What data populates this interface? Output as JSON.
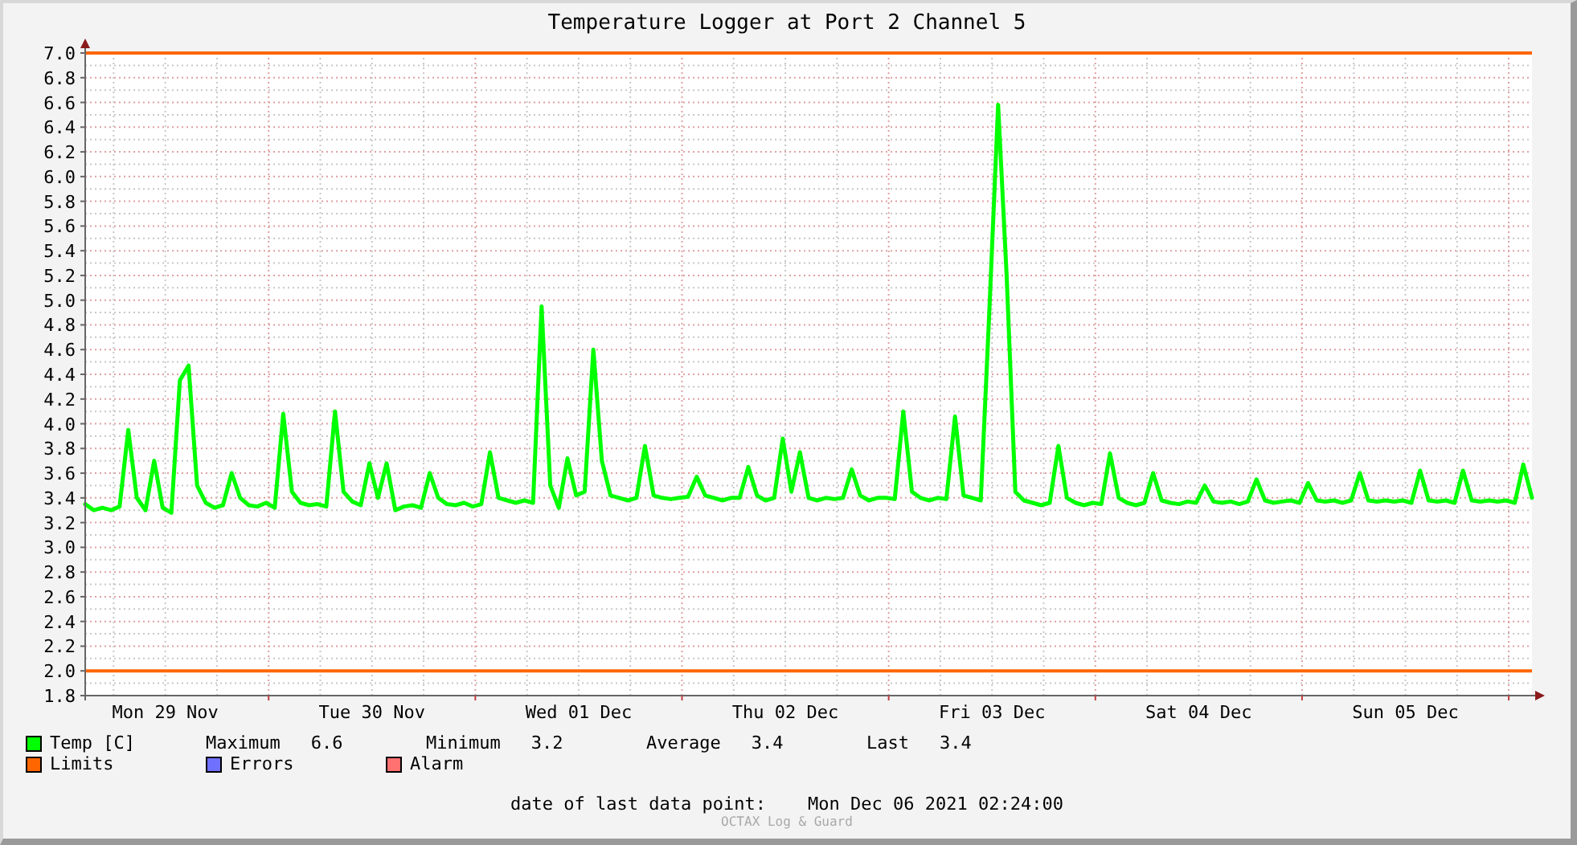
{
  "chart": {
    "chart_data": {
      "type": "line",
      "title": "Temperature Logger at Port 2 Channel 5",
      "categories": [
        null,
        null,
        null,
        null,
        null,
        null,
        null,
        null,
        null,
        "Mon 29 Nov",
        null,
        null,
        null,
        null,
        null,
        null,
        null,
        null,
        null,
        null,
        null,
        null,
        null,
        null,
        null,
        null,
        null,
        null,
        null,
        null,
        null,
        null,
        null,
        "Tue 30 Nov",
        null,
        null,
        null,
        null,
        null,
        null,
        null,
        null,
        null,
        null,
        null,
        null,
        null,
        null,
        null,
        null,
        null,
        null,
        null,
        null,
        null,
        null,
        null,
        "Wed 01 Dec",
        null,
        null,
        null,
        null,
        null,
        null,
        null,
        null,
        null,
        null,
        null,
        null,
        null,
        null,
        null,
        null,
        null,
        null,
        null,
        null,
        null,
        null,
        null,
        "Thu 02 Dec",
        null,
        null,
        null,
        null,
        null,
        null,
        null,
        null,
        null,
        null,
        null,
        null,
        null,
        null,
        null,
        null,
        null,
        null,
        null,
        null,
        null,
        null,
        null,
        "Fri 03 Dec",
        null,
        null,
        null,
        null,
        null,
        null,
        null,
        null,
        null,
        null,
        null,
        null,
        null,
        null,
        null,
        null,
        null,
        null,
        null,
        null,
        null,
        null,
        null,
        "Sat 04 Dec",
        null,
        null,
        null,
        null,
        null,
        null,
        null,
        null,
        null,
        null,
        null,
        null,
        null,
        null,
        null,
        null,
        null,
        null,
        null,
        null,
        null,
        null,
        null,
        "Sun 05 Dec",
        null,
        null,
        null,
        null,
        null,
        null,
        null,
        null,
        null,
        null,
        null,
        null,
        null,
        null,
        null
      ],
      "series": [
        {
          "name": "Temp [C]",
          "color": "#00ff00",
          "values": [
            3.35,
            3.3,
            3.32,
            3.3,
            3.33,
            3.95,
            3.4,
            3.3,
            3.7,
            3.32,
            3.28,
            4.35,
            4.47,
            3.5,
            3.36,
            3.32,
            3.34,
            3.6,
            3.4,
            3.34,
            3.33,
            3.36,
            3.32,
            4.08,
            3.45,
            3.36,
            3.34,
            3.35,
            3.33,
            4.1,
            3.45,
            3.37,
            3.34,
            3.68,
            3.4,
            3.68,
            3.3,
            3.33,
            3.34,
            3.32,
            3.6,
            3.4,
            3.35,
            3.34,
            3.36,
            3.33,
            3.35,
            3.77,
            3.4,
            3.38,
            3.36,
            3.38,
            3.36,
            4.95,
            3.5,
            3.32,
            3.72,
            3.42,
            3.45,
            4.6,
            3.7,
            3.42,
            3.4,
            3.38,
            3.4,
            3.82,
            3.42,
            3.4,
            3.39,
            3.4,
            3.41,
            3.57,
            3.42,
            3.4,
            3.38,
            3.4,
            3.4,
            3.65,
            3.42,
            3.38,
            3.4,
            3.88,
            3.45,
            3.77,
            3.4,
            3.38,
            3.4,
            3.39,
            3.4,
            3.63,
            3.42,
            3.38,
            3.4,
            3.4,
            3.39,
            4.1,
            3.45,
            3.4,
            3.38,
            3.4,
            3.39,
            4.06,
            3.42,
            3.4,
            3.38,
            4.93,
            6.58,
            5.2,
            3.45,
            3.38,
            3.36,
            3.34,
            3.36,
            3.82,
            3.4,
            3.36,
            3.34,
            3.36,
            3.35,
            3.76,
            3.4,
            3.36,
            3.34,
            3.36,
            3.6,
            3.38,
            3.36,
            3.35,
            3.37,
            3.36,
            3.5,
            3.37,
            3.36,
            3.37,
            3.35,
            3.37,
            3.55,
            3.38,
            3.36,
            3.37,
            3.38,
            3.36,
            3.52,
            3.38,
            3.37,
            3.38,
            3.36,
            3.38,
            3.6,
            3.38,
            3.37,
            3.38,
            3.37,
            3.38,
            3.36,
            3.62,
            3.38,
            3.37,
            3.38,
            3.36,
            3.62,
            3.38,
            3.37,
            3.38,
            3.37,
            3.38,
            3.36,
            3.67,
            3.4
          ]
        },
        {
          "name": "Limits",
          "color": "#ff6600",
          "values": [
            2,
            2,
            2,
            2,
            2,
            2,
            2,
            2,
            2,
            2,
            2,
            2,
            2,
            2,
            2,
            2,
            2,
            2,
            2,
            2,
            2,
            2,
            2,
            2,
            2,
            2,
            2,
            2,
            2,
            2,
            2,
            2,
            2,
            2,
            2,
            2,
            2,
            2,
            2,
            2,
            2,
            2,
            2,
            2,
            2,
            2,
            2,
            2,
            2,
            2,
            2,
            2,
            2,
            2,
            2,
            2,
            2,
            2,
            2,
            2,
            2,
            2,
            2,
            2,
            2,
            2,
            2,
            2,
            2,
            2,
            2,
            2,
            2,
            2,
            2,
            2,
            2,
            2,
            2,
            2,
            2,
            2,
            2,
            2,
            2,
            2,
            2,
            2,
            2,
            2,
            2,
            2,
            2,
            2,
            2,
            2,
            2,
            2,
            2,
            2,
            2,
            2,
            2,
            2,
            2,
            2,
            2,
            2,
            2,
            2,
            2,
            2,
            2,
            2,
            2,
            2,
            2,
            2,
            2,
            2,
            2,
            2,
            2,
            2,
            2,
            2,
            2,
            2,
            2,
            2,
            2,
            2,
            2,
            2,
            2,
            2,
            2,
            2,
            2,
            2,
            2,
            2,
            2,
            2,
            2,
            2,
            2,
            2,
            2,
            2,
            2,
            2,
            2,
            2,
            2,
            2,
            2,
            2,
            2,
            2,
            2,
            2,
            2,
            2,
            2,
            2,
            2,
            2,
            2
          ]
        }
      ],
      "ylim": [
        1.8,
        7.0
      ],
      "yticks": [
        {
          "value": 1.8,
          "label": "1.8"
        },
        {
          "value": 2.0,
          "label": "2.0"
        },
        {
          "value": 2.2,
          "label": "2.2"
        },
        {
          "value": 2.4,
          "label": "2.4"
        },
        {
          "value": 2.6,
          "label": "2.6"
        },
        {
          "value": 2.8,
          "label": "2.8"
        },
        {
          "value": 3.0,
          "label": "3.0"
        },
        {
          "value": 3.2,
          "label": "3.2"
        },
        {
          "value": 3.4,
          "label": "3.4"
        },
        {
          "value": 3.6,
          "label": "3.6"
        },
        {
          "value": 3.8,
          "label": "3.8"
        },
        {
          "value": 4.0,
          "label": "4.0"
        },
        {
          "value": 4.2,
          "label": "4.2"
        },
        {
          "value": 4.4,
          "label": "4.4"
        },
        {
          "value": 4.6,
          "label": "4.6"
        },
        {
          "value": 4.8,
          "label": "4.8"
        },
        {
          "value": 5.0,
          "label": "5.0"
        },
        {
          "value": 5.2,
          "label": "5.2"
        },
        {
          "value": 5.4,
          "label": "5.4"
        },
        {
          "value": 5.6,
          "label": "5.6"
        },
        {
          "value": 5.8,
          "label": "5.8"
        },
        {
          "value": 6.0,
          "label": "6.0"
        },
        {
          "value": 6.2,
          "label": "6.2"
        },
        {
          "value": 6.4,
          "label": "6.4"
        },
        {
          "value": 6.6,
          "label": "6.6"
        },
        {
          "value": 6.8,
          "label": "6.8"
        },
        {
          "value": 7.0,
          "label": "7.0"
        }
      ],
      "grid": true
    }
  },
  "legend": {
    "rows": [
      {
        "stats": [
          {
            "label": "Maximum",
            "value": "6.6"
          },
          {
            "label": "Minimum",
            "value": "3.2"
          },
          {
            "label": "Average",
            "value": "3.4"
          },
          {
            "label": "Last",
            "value": "3.4"
          }
        ]
      },
      {
        "items": [
          {
            "label": "Errors",
            "color": "#7070ff"
          },
          {
            "label": "Alarm",
            "color": "#ff7070"
          }
        ]
      }
    ]
  },
  "footer": {
    "label": "date of last data point:",
    "value": "Mon Dec 06 2021 02:24:00"
  },
  "watermark": "OCTAX Log & Guard"
}
